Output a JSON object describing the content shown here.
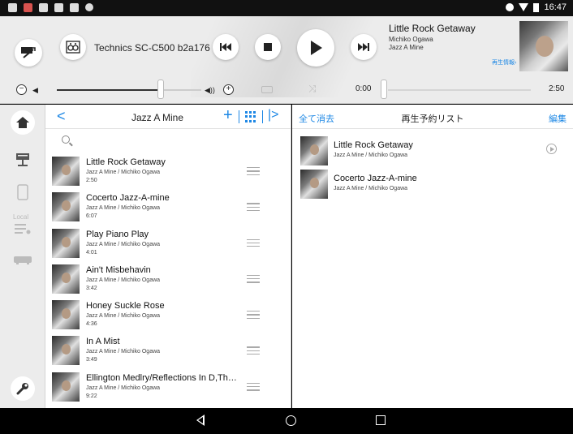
{
  "statusbar": {
    "time": "16:47"
  },
  "player": {
    "device_name": "Technics SC-C500 b2a176",
    "now_playing": {
      "title": "Little Rock Getaway",
      "artist": "Michiko Ogawa",
      "album": "Jazz A Mine",
      "info_link": "再生情報›"
    },
    "time_current": "0:00",
    "time_total": "2:50",
    "volume_level": 0.72,
    "seek_progress": 0.0
  },
  "sidebar": {
    "items": [
      {
        "icon": "home-icon"
      },
      {
        "icon": "server-icon"
      },
      {
        "icon": "tablet-icon"
      },
      {
        "icon": "local-music-icon",
        "label": "Local"
      },
      {
        "icon": "radio-device-icon"
      },
      {
        "icon": "settings-wrench-icon"
      }
    ]
  },
  "library": {
    "title": "Jazz A Mine",
    "tracks": [
      {
        "title": "Little Rock Getaway",
        "subtitle": "Jazz A Mine / Michiko Ogawa",
        "duration": "2:50"
      },
      {
        "title": "Cocerto Jazz-A-mine",
        "subtitle": "Jazz A Mine / Michiko Ogawa",
        "duration": "6:07"
      },
      {
        "title": "Play Piano Play",
        "subtitle": "Jazz A Mine / Michiko Ogawa",
        "duration": "4:01"
      },
      {
        "title": "Ain't Misbehavin",
        "subtitle": "Jazz A Mine / Michiko Ogawa",
        "duration": "3:42"
      },
      {
        "title": "Honey Suckle Rose",
        "subtitle": "Jazz A Mine / Michiko Ogawa",
        "duration": "4:36"
      },
      {
        "title": "In A Mist",
        "subtitle": "Jazz A Mine / Michiko Ogawa",
        "duration": "3:49"
      },
      {
        "title": "Ellington Medlry/Reflections In D,The...",
        "subtitle": "Jazz A Mine / Michiko Ogawa",
        "duration": "9:22"
      }
    ]
  },
  "queue": {
    "clear_label": "全て消去",
    "title": "再生予約リスト",
    "edit_label": "編集",
    "items": [
      {
        "title": "Little Rock Getaway",
        "subtitle": "Jazz A Mine / Michiko Ogawa"
      },
      {
        "title": "Cocerto Jazz-A-mine",
        "subtitle": "Jazz A Mine / Michiko Ogawa"
      }
    ]
  },
  "colors": {
    "accent": "#1e88e5",
    "panel": "#ececec"
  }
}
